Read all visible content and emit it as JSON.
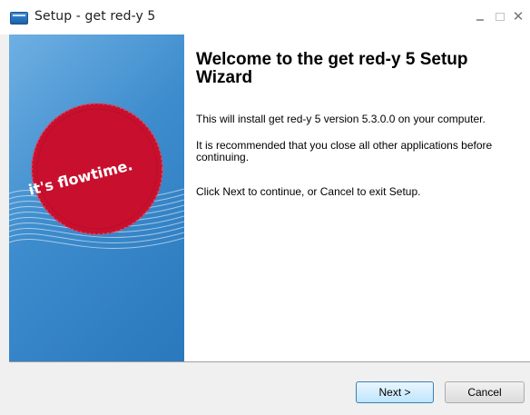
{
  "window": {
    "title": "Setup - get red-y 5",
    "controls": [
      "minimize-icon",
      "maximize-icon",
      "close-icon"
    ],
    "close_glyph": "✕"
  },
  "banner": {
    "slogan": "it's flowtime.",
    "colors": {
      "circle": "#c8102e",
      "background": "#3d8ccd"
    }
  },
  "content": {
    "heading": "Welcome to the get red-y 5 Setup Wizard",
    "paragraphs": [
      "This will install get red-y 5 version 5.3.0.0 on your computer.",
      "It is recommended that you close all other applications before continuing.",
      "Click Next to continue, or Cancel to exit Setup."
    ]
  },
  "buttons": {
    "next": "Next >",
    "cancel": "Cancel"
  }
}
